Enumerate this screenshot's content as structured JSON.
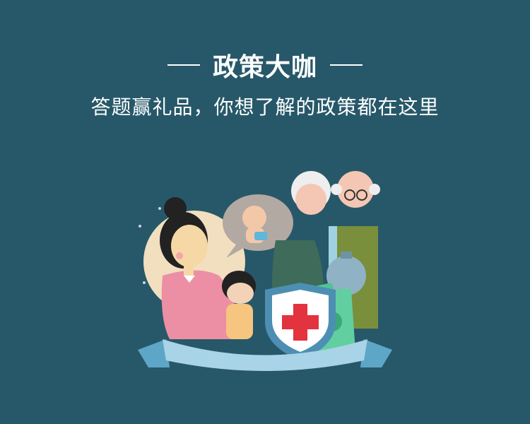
{
  "header": {
    "title": "政策大咖",
    "subtitle": "答题赢礼品，你想了解的政策都在这里"
  },
  "colors": {
    "background": "#275869",
    "text": "#ffffff",
    "shield_red": "#e2333e",
    "money_green": "#52c293",
    "ribbon": "#a9d3e6"
  },
  "illustration": {
    "icons": [
      "pregnant-woman",
      "baby-thought-bubble",
      "child",
      "elderly-couple",
      "health-shield-icon",
      "money-stack",
      "piggy-bank",
      "ribbon-banner"
    ]
  }
}
